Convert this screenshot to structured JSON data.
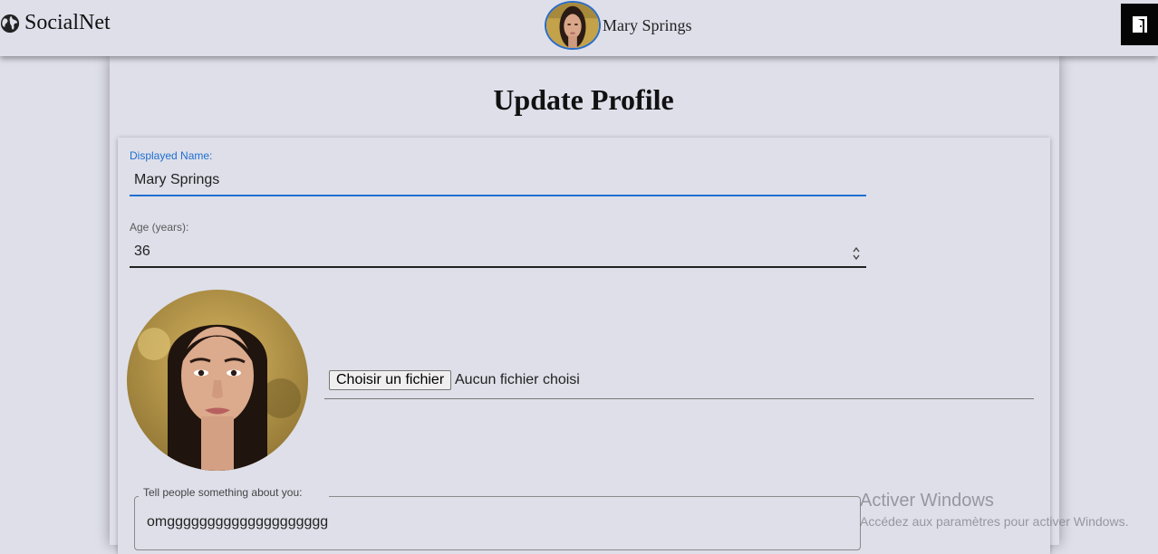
{
  "header": {
    "brand": "SocialNet",
    "user_name": "Mary Springs",
    "icons": {
      "brand": "globe-icon",
      "logout": "door-exit-icon"
    }
  },
  "page": {
    "title": "Update Profile"
  },
  "form": {
    "name_label": "Displayed Name:",
    "name_value": "Mary Springs",
    "age_label": "Age (years):",
    "age_value": "36",
    "file_button": "Choisir un fichier",
    "file_status": "Aucun fichier choisi",
    "bio_label": "Tell people something about you:",
    "bio_value": "omgggggggggggggggggggg"
  },
  "watermark": {
    "title": "Activer Windows",
    "subtitle": "Accédez aux paramètres pour activer Windows."
  },
  "colors": {
    "background": "#dedfe9",
    "focus_accent": "#1e6fd0",
    "avatar_ring": "#2a6cc4",
    "logout_bg": "#050505"
  }
}
